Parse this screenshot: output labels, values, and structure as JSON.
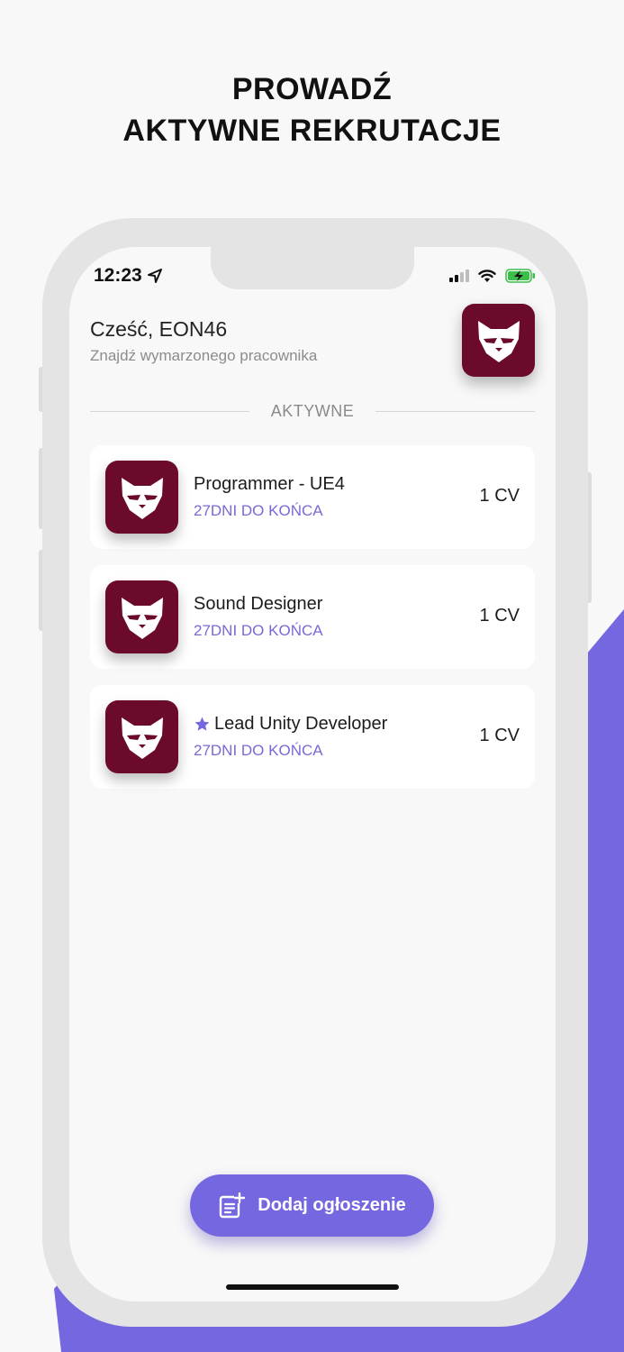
{
  "colors": {
    "accent": "#7567e0",
    "brand": "#6c0a2b",
    "deadline": "#7b68d6"
  },
  "headline": {
    "line1": "PROWADŹ",
    "line2": "AKTYWNE REKRUTACJE"
  },
  "status_bar": {
    "time": "12:23",
    "location_icon": "location-arrow-icon",
    "signal_icon": "cellular-signal-icon",
    "wifi_icon": "wifi-icon",
    "battery_icon": "battery-charging-icon"
  },
  "header": {
    "greeting": "Cześć, EON46",
    "subtitle": "Znajdź wymarzonego pracownika",
    "avatar_icon": "company-logo-icon"
  },
  "section": {
    "label": "AKTYWNE"
  },
  "jobs": [
    {
      "title": "Programmer - UE4",
      "deadline": "27DNI DO KOŃCA",
      "cv": "1 CV",
      "featured": false
    },
    {
      "title": "Sound Designer",
      "deadline": "27DNI DO KOŃCA",
      "cv": "1 CV",
      "featured": false
    },
    {
      "title": "Lead Unity Developer",
      "deadline": "27DNI DO KOŃCA",
      "cv": "1 CV",
      "featured": true
    }
  ],
  "add_button": {
    "label": "Dodaj ogłoszenie",
    "icon": "add-note-icon"
  }
}
